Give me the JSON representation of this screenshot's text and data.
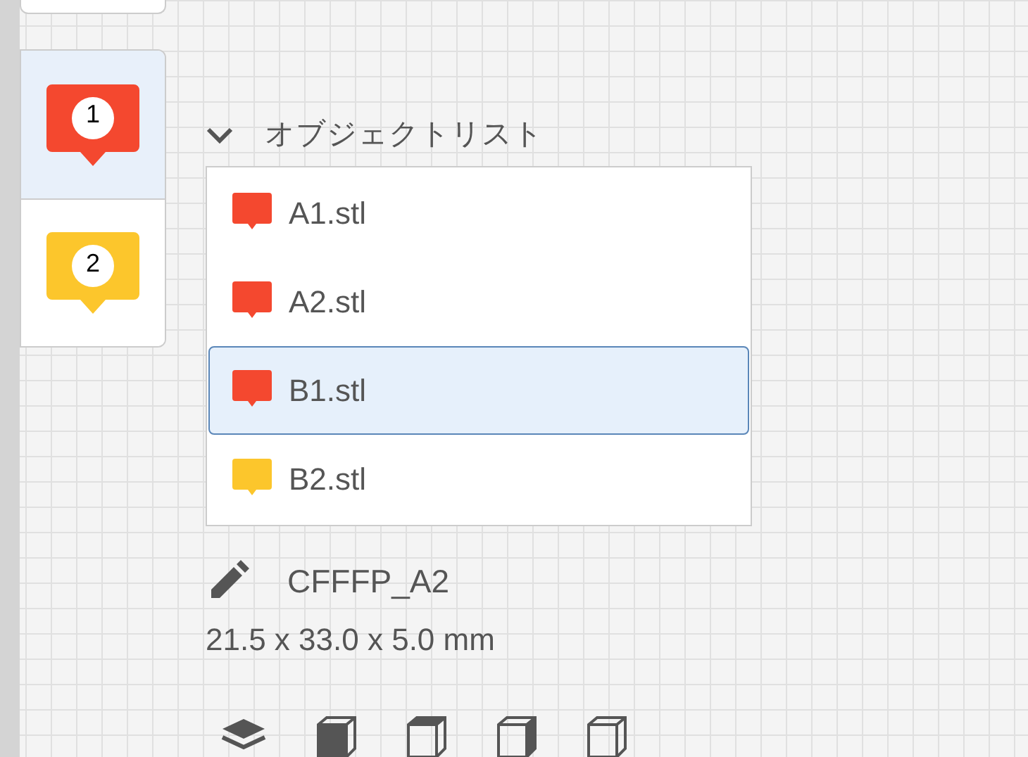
{
  "object_tabs": [
    {
      "label": "1",
      "color": "#f4482f",
      "selected": true
    },
    {
      "label": "2",
      "color": "#fcc62c",
      "selected": false
    }
  ],
  "object_list": {
    "title": "オブジェクトリスト",
    "expanded": true,
    "items": [
      {
        "name": "A1.stl",
        "color": "#f4482f",
        "selected": false
      },
      {
        "name": "A2.stl",
        "color": "#f4482f",
        "selected": false
      },
      {
        "name": "B1.stl",
        "color": "#f4482f",
        "selected": true
      },
      {
        "name": "B2.stl",
        "color": "#fcc62c",
        "selected": false
      }
    ]
  },
  "object": {
    "name": "CFFFP_A2",
    "dimensions": "21.5 x 33.0 x 5.0 mm"
  }
}
